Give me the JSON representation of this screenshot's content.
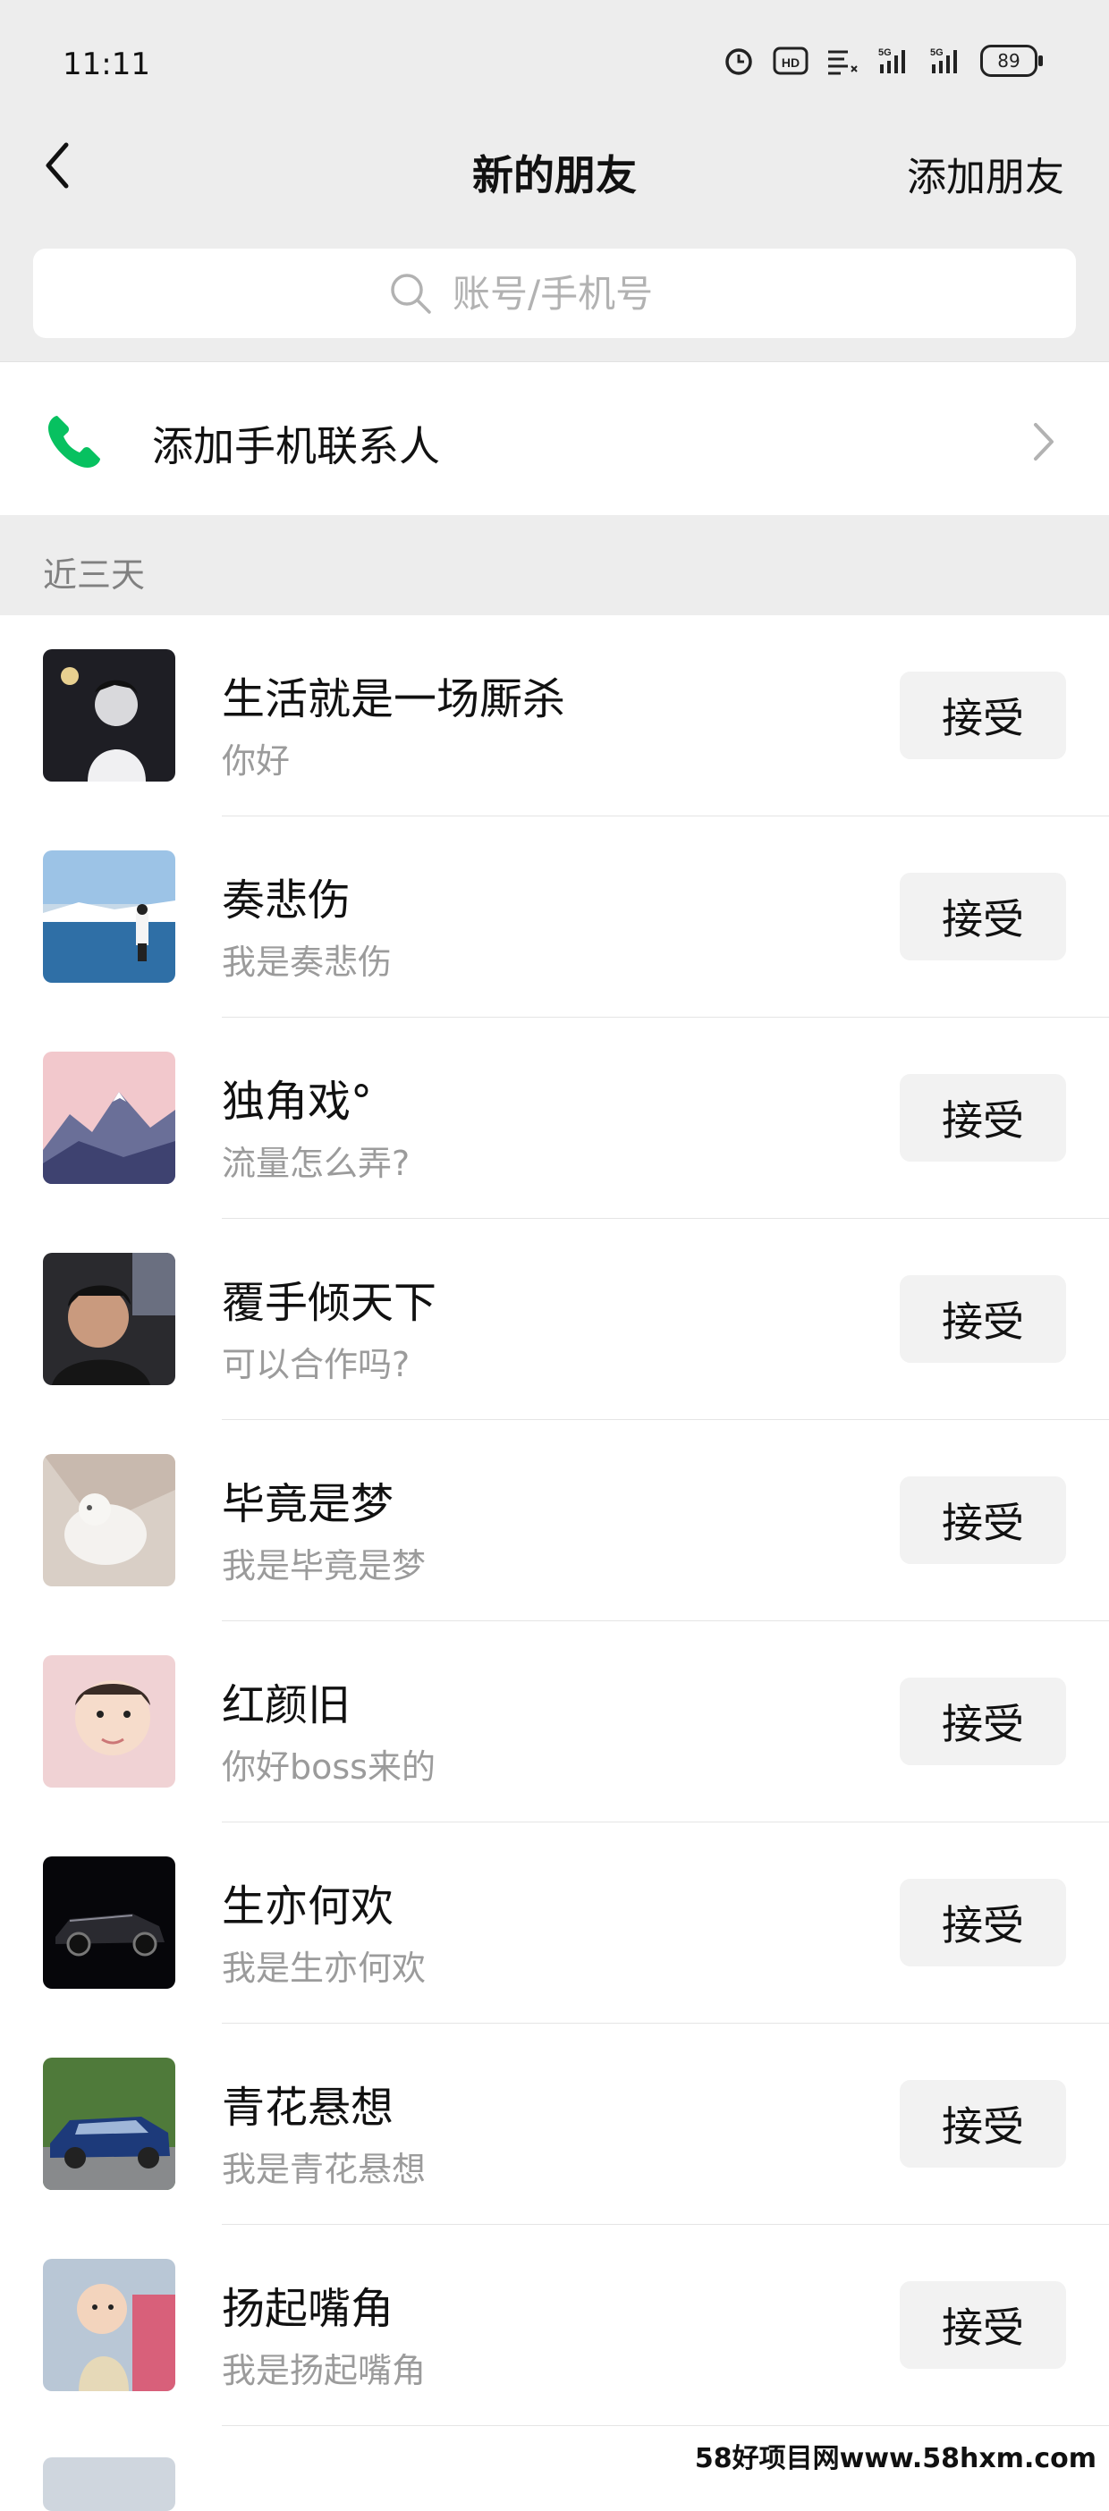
{
  "status_bar": {
    "time": "11:11",
    "battery": "89"
  },
  "nav": {
    "title": "新的朋友",
    "action": "添加朋友"
  },
  "search": {
    "placeholder": "账号/手机号"
  },
  "contacts_entry": {
    "label": "添加手机联系人"
  },
  "section": {
    "label": "近三天"
  },
  "requests": [
    {
      "name": "生活就是一场厮杀",
      "message": "你好",
      "button": "接受"
    },
    {
      "name": "奏悲伤",
      "message": "我是奏悲伤",
      "button": "接受"
    },
    {
      "name": "独角戏°",
      "message": "流量怎么弄?",
      "button": "接受"
    },
    {
      "name": "覆手倾天下",
      "message": "可以合作吗?",
      "button": "接受"
    },
    {
      "name": "毕竟是梦",
      "message": "我是毕竟是梦",
      "button": "接受"
    },
    {
      "name": "红颜旧",
      "message": "你好boss来的",
      "button": "接受"
    },
    {
      "name": "生亦何欢",
      "message": "我是生亦何欢",
      "button": "接受"
    },
    {
      "name": "青花悬想",
      "message": "我是青花悬想",
      "button": "接受"
    },
    {
      "name": "扬起嘴角",
      "message": "我是扬起嘴角",
      "button": "接受"
    }
  ],
  "watermark": "58好项目网www.58hxm.com",
  "colors": {
    "background": "#ededed",
    "phone_green": "#07c160",
    "button_bg": "#f2f2f2",
    "secondary_text": "#9b9b9b"
  }
}
